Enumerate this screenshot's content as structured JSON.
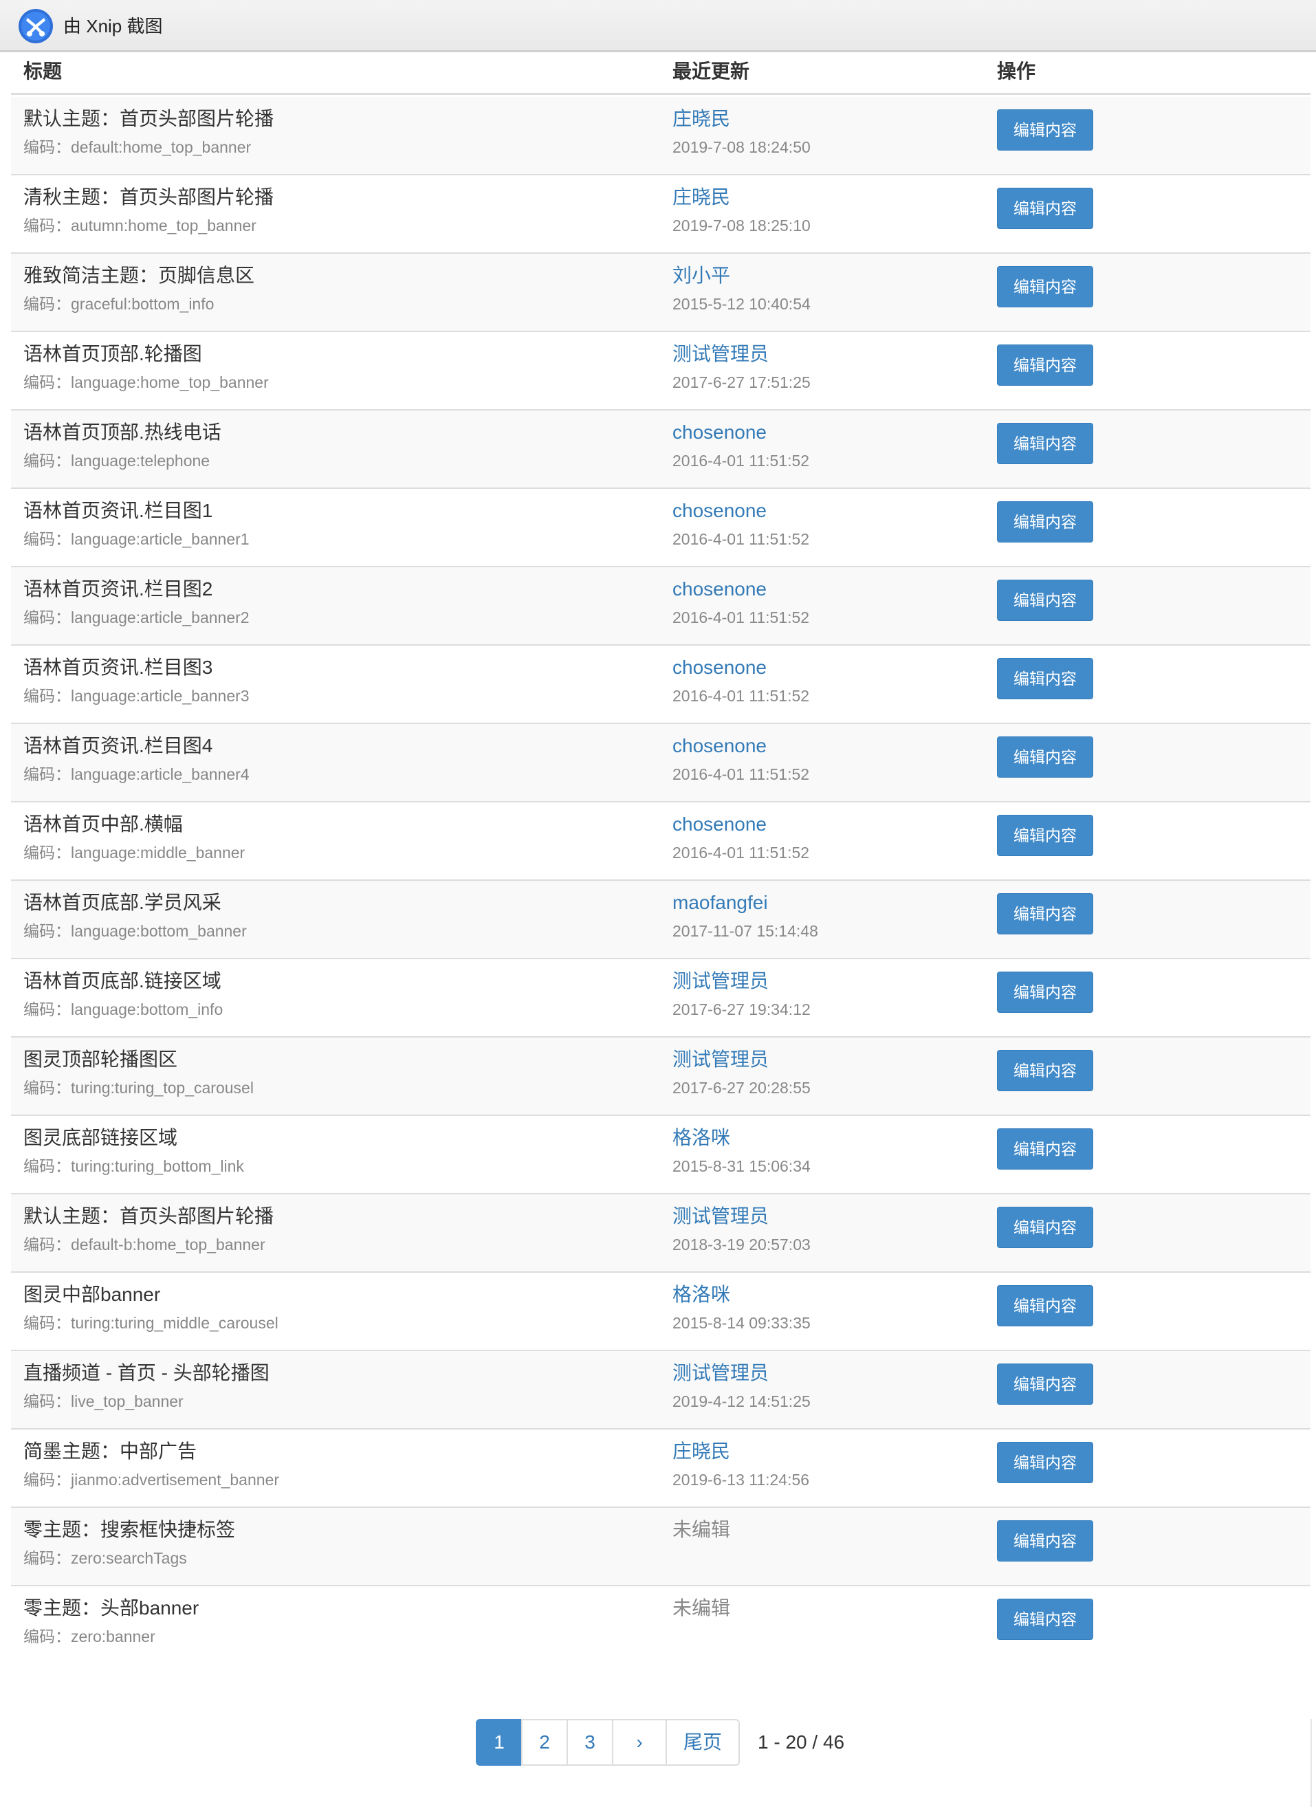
{
  "window": {
    "title": "由 Xnip 截图"
  },
  "table": {
    "headers": {
      "title": "标题",
      "updated": "最近更新",
      "ops": "操作"
    },
    "code_prefix": "编码：",
    "edit_label": "编辑内容",
    "rows": [
      {
        "title": "默认主题：首页头部图片轮播",
        "code": "default:home_top_banner",
        "user": "庄晓民",
        "time": "2019-7-08 18:24:50"
      },
      {
        "title": "清秋主题：首页头部图片轮播",
        "code": "autumn:home_top_banner",
        "user": "庄晓民",
        "time": "2019-7-08 18:25:10"
      },
      {
        "title": "雅致简洁主题：页脚信息区",
        "code": "graceful:bottom_info",
        "user": "刘小平",
        "time": "2015-5-12 10:40:54"
      },
      {
        "title": "语林首页顶部.轮播图",
        "code": "language:home_top_banner",
        "user": "测试管理员",
        "time": "2017-6-27 17:51:25"
      },
      {
        "title": "语林首页顶部.热线电话",
        "code": "language:telephone",
        "user": "chosenone",
        "time": "2016-4-01 11:51:52"
      },
      {
        "title": "语林首页资讯.栏目图1",
        "code": "language:article_banner1",
        "user": "chosenone",
        "time": "2016-4-01 11:51:52"
      },
      {
        "title": "语林首页资讯.栏目图2",
        "code": "language:article_banner2",
        "user": "chosenone",
        "time": "2016-4-01 11:51:52"
      },
      {
        "title": "语林首页资讯.栏目图3",
        "code": "language:article_banner3",
        "user": "chosenone",
        "time": "2016-4-01 11:51:52"
      },
      {
        "title": "语林首页资讯.栏目图4",
        "code": "language:article_banner4",
        "user": "chosenone",
        "time": "2016-4-01 11:51:52"
      },
      {
        "title": "语林首页中部.横幅",
        "code": "language:middle_banner",
        "user": "chosenone",
        "time": "2016-4-01 11:51:52"
      },
      {
        "title": "语林首页底部.学员风采",
        "code": "language:bottom_banner",
        "user": "maofangfei",
        "time": "2017-11-07 15:14:48"
      },
      {
        "title": "语林首页底部.链接区域",
        "code": "language:bottom_info",
        "user": "测试管理员",
        "time": "2017-6-27 19:34:12"
      },
      {
        "title": "图灵顶部轮播图区",
        "code": "turing:turing_top_carousel",
        "user": "测试管理员",
        "time": "2017-6-27 20:28:55"
      },
      {
        "title": "图灵底部链接区域",
        "code": "turing:turing_bottom_link",
        "user": "格洛咪",
        "time": "2015-8-31 15:06:34"
      },
      {
        "title": "默认主题：首页头部图片轮播",
        "code": "default-b:home_top_banner",
        "user": "测试管理员",
        "time": "2018-3-19 20:57:03"
      },
      {
        "title": "图灵中部banner",
        "code": "turing:turing_middle_carousel",
        "user": "格洛咪",
        "time": "2015-8-14 09:33:35"
      },
      {
        "title": "直播频道 - 首页 - 头部轮播图",
        "code": "live_top_banner",
        "user": "测试管理员",
        "time": "2019-4-12 14:51:25"
      },
      {
        "title": "简墨主题：中部广告",
        "code": "jianmo:advertisement_banner",
        "user": "庄晓民",
        "time": "2019-6-13 11:24:56"
      },
      {
        "title": "零主题：搜索框快捷标签",
        "code": "zero:searchTags",
        "user": "未编辑",
        "time": ""
      },
      {
        "title": "零主题：头部banner",
        "code": "zero:banner",
        "user": "未编辑",
        "time": ""
      }
    ]
  },
  "pagination": {
    "pages": [
      "1",
      "2",
      "3"
    ],
    "active": "1",
    "next": "›",
    "last": "尾页",
    "summary": "1 - 20 / 46"
  },
  "colors": {
    "link": "#337ab7",
    "button": "#428bca",
    "muted": "#888888",
    "stripe": "#f9f9f9"
  }
}
